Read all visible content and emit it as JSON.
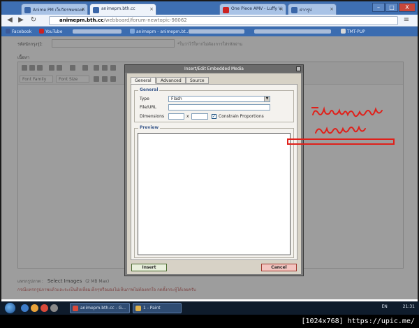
{
  "browser": {
    "tabs": [
      {
        "label": "Anime PM เว็บวิธรชมของด",
        "fav_color": "#3a66a8",
        "active": false
      },
      {
        "label": "animepm.bth.cc",
        "fav_color": "#3a66a8",
        "active": true
      },
      {
        "label": "One Piece AMV - Luffy V",
        "fav_color": "#cc2222",
        "active": false
      },
      {
        "label": "ฝากรูป",
        "fav_color": "#3a66a8",
        "active": false
      }
    ],
    "url_domain": "animepm.bth.cc",
    "url_path": "/webboard/forum-newtopic-98062",
    "bookmarks": [
      "Facebook",
      "YouTube",
      "animepm - animepm.bt..",
      "TMT-PUP"
    ],
    "window_buttons": [
      "–",
      "□",
      "X"
    ]
  },
  "page": {
    "field_label": "รหัสนักกรุงรุ่]:",
    "field_hint": "*ในว่าไว้ใหากไม่ต้องการใส่รหัสผ่าน",
    "section_label": "เนื้อหา",
    "font_family_placeholder": "Font Family",
    "font_size_placeholder": "Font Size",
    "upload_label": "แทรกรูปภาพ :",
    "select_images": "Select Images",
    "max_size": "(2 MB Max)",
    "warning": "กรณีแทรกรูปภาพแล้วและจะเป็นสีเหลี่ยมเล็กๆหรือมองไม่เห็นภาพไม่ต้องตกใจ กดตั้งกระทู้ได้เลยครับ"
  },
  "dialog": {
    "title": "Insert/Edit Embedded Media",
    "tabs": [
      "General",
      "Advanced",
      "Source"
    ],
    "general_legend": "General",
    "type_label": "Type",
    "type_value": "Flash",
    "file_label": "File/URL",
    "file_value": "",
    "dimensions_label": "Dimensions",
    "dim_sep": "x",
    "constrain_label": "Constrain Proportions",
    "constrain_checked": "✓",
    "preview_legend": "Preview",
    "insert_label": "Insert",
    "cancel_label": "Cancel"
  },
  "annotation": {
    "color": "#e0201a"
  },
  "taskbar": {
    "tasks": [
      "animepm.bth.cc - G...",
      "1 - Paint"
    ],
    "lang": "EN",
    "time": "21:31"
  },
  "caption": "[1024x768] https://upic.me/"
}
